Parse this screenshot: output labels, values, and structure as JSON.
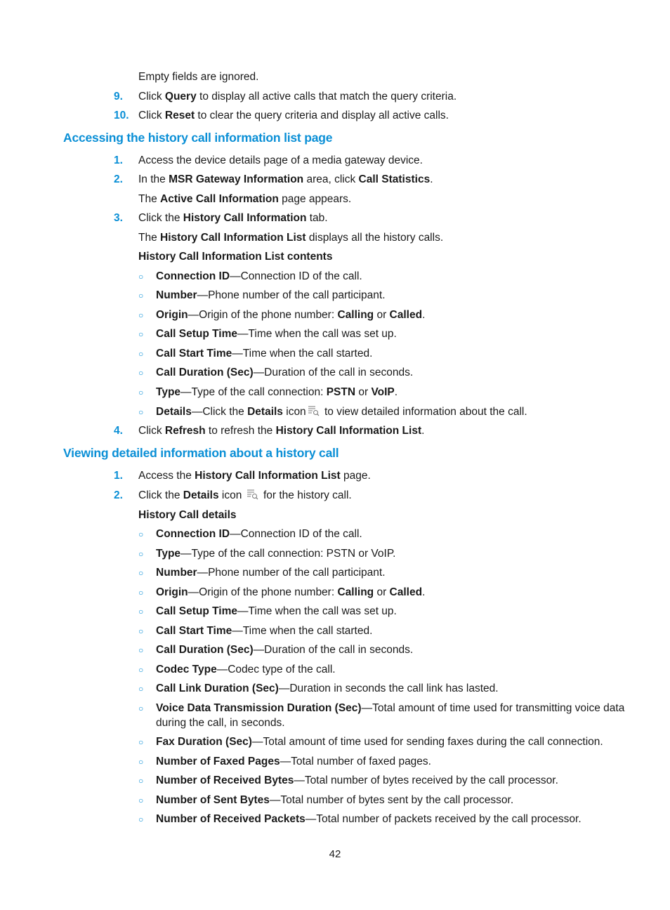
{
  "page_number": "42",
  "intro": {
    "note": "Empty fields are ignored.",
    "steps": [
      {
        "num": "9.",
        "pre": "Click ",
        "b1": "Query",
        "post": " to display all active calls that match the query criteria."
      },
      {
        "num": "10.",
        "pre": "Click ",
        "b1": "Reset",
        "post": " to clear the query criteria and display all active calls."
      }
    ]
  },
  "section1": {
    "title": "Accessing the history call information list page",
    "step1": {
      "num": "1.",
      "text": "Access the device details page of a media gateway device."
    },
    "step2": {
      "num": "2.",
      "pre": "In the ",
      "b1": "MSR Gateway Information",
      "mid": " area, click ",
      "b2": "Call Statistics",
      "post": "."
    },
    "step2_note": {
      "pre": "The ",
      "b1": "Active Call Information",
      "post": " page appears."
    },
    "step3": {
      "num": "3.",
      "pre": "Click the ",
      "b1": "History Call Information",
      "post": " tab."
    },
    "step3_note": {
      "pre": "The ",
      "b1": "History Call Information List",
      "post": " displays all the history calls."
    },
    "list_title": "History Call Information List contents",
    "items": [
      {
        "term": "Connection ID",
        "desc": "—Connection ID of the call."
      },
      {
        "term": "Number",
        "desc": "—Phone number of the call participant."
      },
      {
        "term": "Origin",
        "desc": "—Origin of the phone number: ",
        "b1": "Calling",
        "mid": " or ",
        "b2": "Called",
        "post": "."
      },
      {
        "term": "Call Setup Time",
        "desc": "—Time when the call was set up."
      },
      {
        "term": "Call Start Time",
        "desc": "—Time when the call started."
      },
      {
        "term": "Call Duration (Sec)",
        "desc": "—Duration of the call in seconds."
      },
      {
        "term": "Type",
        "desc": "—Type of the call connection: ",
        "b1": "PSTN",
        "mid": " or ",
        "b2": "VoIP",
        "post": "."
      },
      {
        "term": "Details",
        "desc": "—Click the ",
        "b1": "Details",
        "mid": " icon",
        "post": " to view detailed information about the call.",
        "icon": "details-list-search-icon"
      }
    ],
    "step4": {
      "num": "4.",
      "pre": "Click ",
      "b1": "Refresh",
      "mid": " to refresh the ",
      "b2": "History Call Information List",
      "post": "."
    }
  },
  "section2": {
    "title": "Viewing detailed information about a history call",
    "step1": {
      "num": "1.",
      "pre": "Access the ",
      "b1": "History Call Information List",
      "post": " page."
    },
    "step2": {
      "num": "2.",
      "pre": "Click the ",
      "b1": "Details",
      "mid": " icon",
      "post": " for the history call.",
      "icon": "details-list-search-icon"
    },
    "list_title": "History Call details",
    "items": [
      {
        "term": "Connection ID",
        "desc": "—Connection ID of the call."
      },
      {
        "term": "Type",
        "desc": "—Type of the call connection: PSTN or VoIP."
      },
      {
        "term": "Number",
        "desc": "—Phone number of the call participant."
      },
      {
        "term": "Origin",
        "desc": "—Origin of the phone number: ",
        "b1": "Calling",
        "mid": " or ",
        "b2": "Called",
        "post": "."
      },
      {
        "term": "Call Setup Time",
        "desc": "—Time when the call was set up."
      },
      {
        "term": "Call Start Time",
        "desc": "—Time when the call started."
      },
      {
        "term": "Call Duration (Sec)",
        "desc": "—Duration of the call in seconds."
      },
      {
        "term": "Codec Type",
        "desc": "—Codec type of the call."
      },
      {
        "term": "Call Link Duration (Sec)",
        "desc": "—Duration in seconds the call link has lasted."
      },
      {
        "term": "Voice Data Transmission Duration (Sec)",
        "desc": "—Total amount of time used for transmitting voice data",
        "cont": "during the call, in seconds."
      },
      {
        "term": "Fax Duration (Sec)",
        "desc": "—Total amount of time used for sending faxes during the call connection."
      },
      {
        "term": "Number of Faxed Pages",
        "desc": "—Total number of faxed pages."
      },
      {
        "term": "Number of Received Bytes",
        "desc": "—Total number of bytes received by the call processor."
      },
      {
        "term": "Number of Sent Bytes",
        "desc": "—Total number of bytes sent by the call processor."
      },
      {
        "term": "Number of Received Packets",
        "desc": "—Total number of packets received by the call processor."
      }
    ]
  },
  "bullet_glyph": "○",
  "colors": {
    "accent": "#0a8fd6",
    "text": "#1a1a1a"
  }
}
